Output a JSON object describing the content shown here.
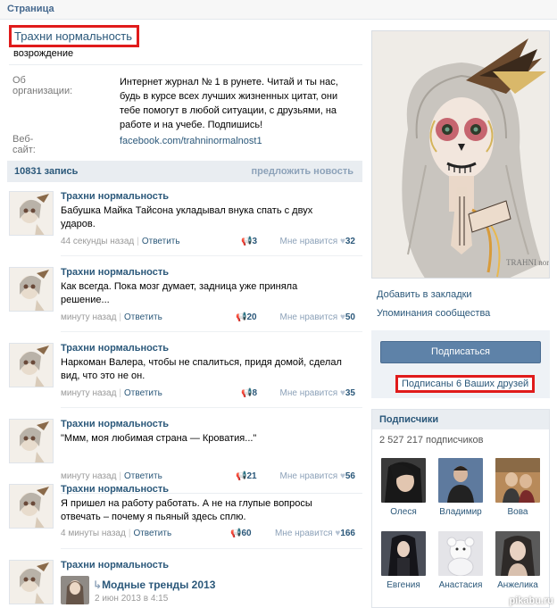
{
  "breadcrumb": "Страница",
  "page": {
    "title": "Трахни нормальность",
    "status": "возрождение"
  },
  "info": {
    "about_label": "Об организации:",
    "about_text": "Интернет журнал № 1 в рунете. Читай и ты нас, будь в курсе всех лучших жизненных цитат, они тебе помогут в любой ситуации, с друзьями, на работе и на учебе. Подпишись!",
    "site_label": "Веб-сайт:",
    "site_url": "facebook.com/trahninormalnost1"
  },
  "wall": {
    "count": "10831 запись",
    "suggest": "предложить новость"
  },
  "labels": {
    "reply": "Ответить",
    "like": "Мне нравится"
  },
  "posts": [
    {
      "author": "Трахни нормальность",
      "text": "Бабушка Майка Тайсона укладывал внука спать с двух ударов.",
      "time": "44 секунды назад",
      "shares": "3",
      "likes": "32"
    },
    {
      "author": "Трахни нормальность",
      "text": "Как всегда. Пока мозг думает, задница уже приняла решение...",
      "time": "минуту назад",
      "shares": "20",
      "likes": "50"
    },
    {
      "author": "Трахни нормальность",
      "text": "Наркоман Валера, чтобы не спалиться, придя домой, сделал вид, что это не он.",
      "time": "минуту назад",
      "shares": "8",
      "likes": "35"
    },
    {
      "author": "Трахни нормальность",
      "text": "\"Ммм, моя любимая страна — Кроватия...\"",
      "time": "минуту назад",
      "shares": "21",
      "likes": "56"
    },
    {
      "author": "Трахни нормальность",
      "text": "Я пришел на работу работать. А не на глупые вопросы отвечать – почему я пьяный здесь сплю.",
      "time": "4 минуты назад",
      "shares": "60",
      "likes": "166"
    },
    {
      "author": "Трахни нормальность",
      "repost_title": "Модные тренды 2013",
      "repost_date": "2 июн 2013 в 4:15"
    }
  ],
  "side": {
    "bookmark": "Добавить в закладки",
    "mentions": "Упоминания сообщества",
    "subscribe": "Подписаться",
    "friends_subscribed": "Подписаны 6 Ваших друзей",
    "cover_sign": "TRAHNI normalnost"
  },
  "members": {
    "title": "Подписчики",
    "count": "2 527 217 подписчиков",
    "list": [
      "Олеся",
      "Владимир",
      "Вова",
      "Евгения",
      "Анастасия",
      "Анжелика"
    ]
  },
  "watermark": "pikabu.ru",
  "colors": {
    "link": "#2b587a",
    "button": "#5e82a8",
    "highlight": "#e01b1b",
    "header_bg": "#e9edf1"
  }
}
